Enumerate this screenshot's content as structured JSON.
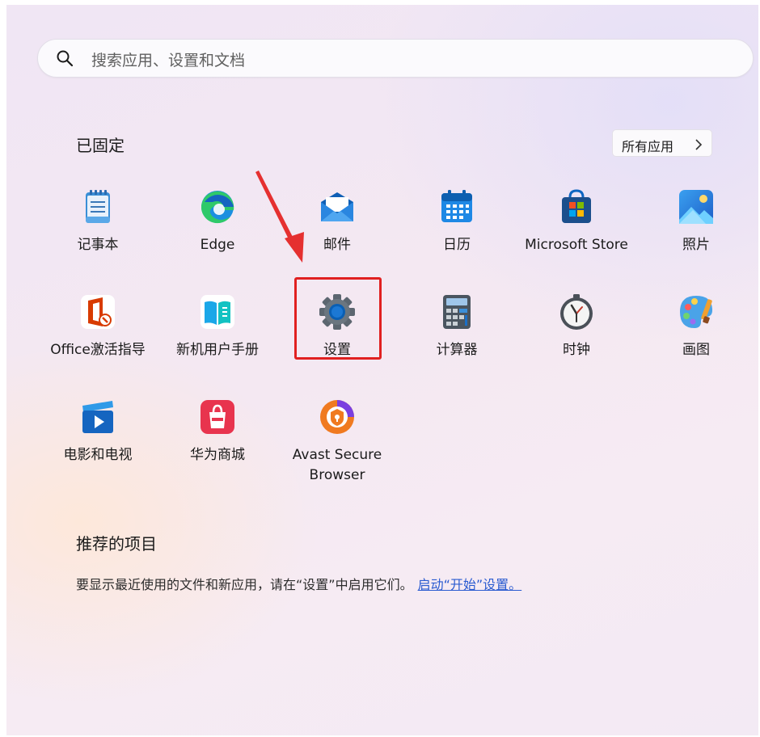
{
  "search": {
    "placeholder": "搜索应用、设置和文档"
  },
  "pinned": {
    "title": "已固定",
    "all_apps_label": "所有应用",
    "apps": [
      {
        "label": "记事本",
        "icon": "notepad-icon"
      },
      {
        "label": "Edge",
        "icon": "edge-icon"
      },
      {
        "label": "邮件",
        "icon": "mail-icon"
      },
      {
        "label": "日历",
        "icon": "calendar-icon"
      },
      {
        "label": "Microsoft Store",
        "icon": "store-icon"
      },
      {
        "label": "照片",
        "icon": "photos-icon"
      },
      {
        "label": "Office激活指导",
        "icon": "office-icon"
      },
      {
        "label": "新机用户手册",
        "icon": "manual-icon"
      },
      {
        "label": "设置",
        "icon": "gear-icon"
      },
      {
        "label": "计算器",
        "icon": "calculator-icon"
      },
      {
        "label": "时钟",
        "icon": "clock-icon"
      },
      {
        "label": "画图",
        "icon": "paint-icon"
      },
      {
        "label": "电影和电视",
        "icon": "movies-icon"
      },
      {
        "label": "华为商城",
        "icon": "vmall-icon"
      },
      {
        "label": "Avast Secure Browser",
        "icon": "avast-icon"
      }
    ]
  },
  "recommended": {
    "title": "推荐的项目",
    "description": "要显示最近使用的文件和新应用，请在“设置”中启用它们。",
    "link": "启动“开始”设置。"
  },
  "colors": {
    "highlight": "#e02020",
    "link": "#2a5bd0",
    "accent": "#0a5fb4"
  }
}
